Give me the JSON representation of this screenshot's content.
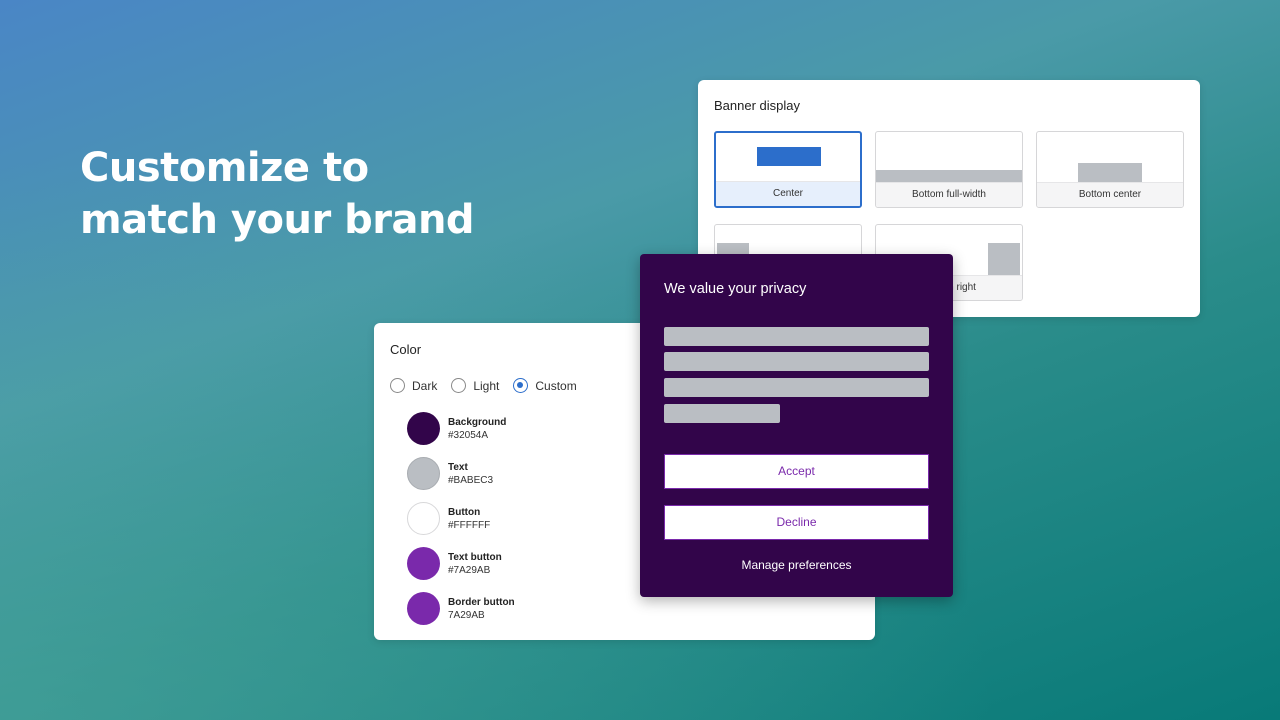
{
  "headline": {
    "line1": "Customize to",
    "line2": "match your brand"
  },
  "banner_display": {
    "title": "Banner display",
    "options": [
      {
        "label": "Center",
        "selected": true
      },
      {
        "label": "Bottom full-width",
        "selected": false
      },
      {
        "label": "Bottom center",
        "selected": false
      },
      {
        "label": "",
        "selected": false
      },
      {
        "label": "Bottom right",
        "selected": false
      }
    ],
    "accent": "#2C6ECB"
  },
  "color_panel": {
    "title": "Color",
    "modes": [
      {
        "label": "Dark",
        "selected": false
      },
      {
        "label": "Light",
        "selected": false
      },
      {
        "label": "Custom",
        "selected": true
      }
    ],
    "swatches": [
      {
        "name": "Background",
        "value": "#32054A",
        "color": "#32054A"
      },
      {
        "name": "Text",
        "value": "#BABEC3",
        "color": "#BABEC3"
      },
      {
        "name": "Button",
        "value": "#FFFFFF",
        "color": "#FFFFFF"
      },
      {
        "name": "Text button",
        "value": "#7A29AB",
        "color": "#7A29AB"
      },
      {
        "name": "Border button",
        "value": "7A29AB",
        "color": "#7A29AB"
      }
    ]
  },
  "privacy_banner": {
    "title": "We value your privacy",
    "accept": "Accept",
    "decline": "Decline",
    "manage": "Manage preferences"
  }
}
